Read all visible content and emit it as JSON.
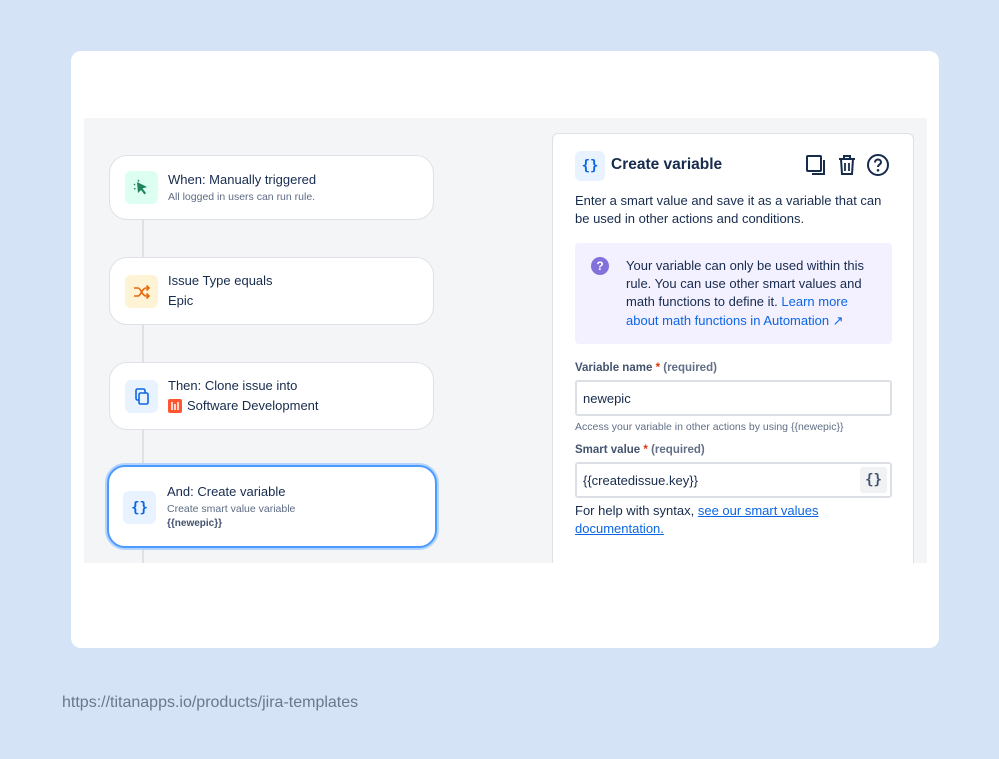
{
  "flow": {
    "nodes": [
      {
        "title": "When: Manually triggered",
        "subtitle": "All logged in users can run rule.",
        "icon": "cursor-click-icon"
      },
      {
        "title": "Issue Type equals",
        "subtitle": "Epic",
        "icon": "shuffle-icon"
      },
      {
        "title": "Then: Clone issue into",
        "subtitle": "Software Development",
        "icon": "copy-icon"
      },
      {
        "title": "And: Create variable",
        "subtitle": "Create smart value variable",
        "detail": "{{newepic}}",
        "icon": "curly-braces-icon"
      }
    ]
  },
  "panel": {
    "icon_text": "{}",
    "title": "Create variable",
    "description": "Enter a smart value and save it as a variable that can be used in other actions and conditions.",
    "info_text": "Your variable can only be used within this rule. You can use other smart values and math functions to define it.",
    "info_link": "Learn more about math functions in Automation ↗",
    "variable_name_label": "Variable name",
    "smart_value_label": "Smart value",
    "required_star": "*",
    "required_text": "(required)",
    "variable_name_value": "newepic",
    "variable_name_helper": "Access your variable in other actions by using {{newepic}}",
    "smart_value_value": "{{createdissue.key}}",
    "smart_value_button": "{}",
    "syntax_text": "For help with syntax,",
    "syntax_link": "see our smart values documentation."
  },
  "footer_url": "https://titanapps.io/products/jira-templates",
  "colors": {
    "page_bg": "#d5e3f7",
    "selected_border": "#4c9aff",
    "link": "#0c66e4",
    "info_bg": "#f3f0ff"
  }
}
